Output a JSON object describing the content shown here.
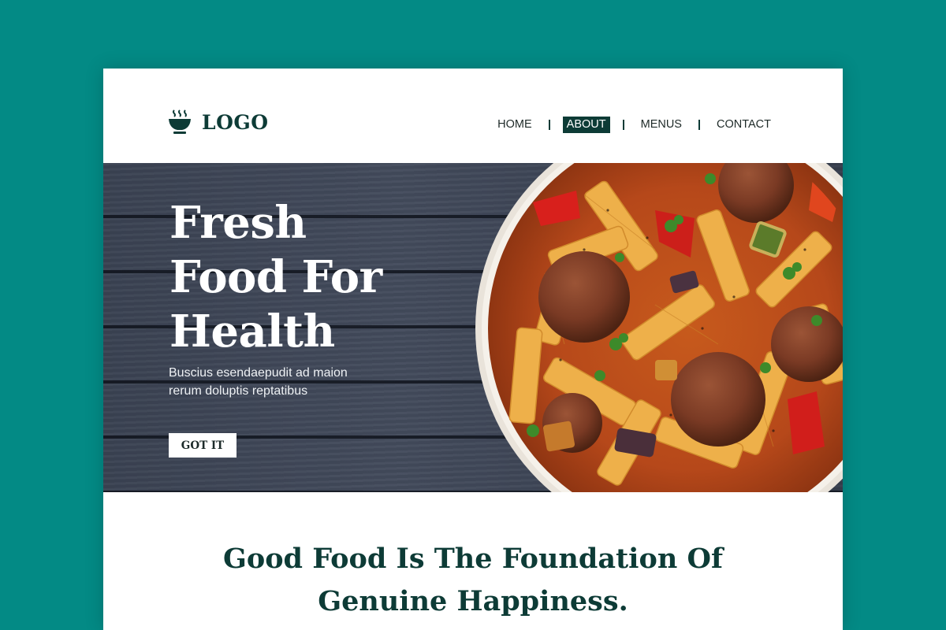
{
  "header": {
    "logo_text": "LOGO",
    "logo_icon": "steaming-bowl-icon",
    "nav": [
      {
        "label": "HOME",
        "active": false
      },
      {
        "label": "ABOUT",
        "active": true
      },
      {
        "label": "MENUS",
        "active": false
      },
      {
        "label": "CONTACT",
        "active": false
      }
    ]
  },
  "hero": {
    "title_lines": [
      "Fresh",
      "Food For",
      "Health"
    ],
    "subtitle_lines": [
      "Buscius esendaepudit ad maion",
      "rerum doluptis reptatibus"
    ],
    "cta_label": "GOT IT",
    "image": "pasta-bowl-with-meatballs"
  },
  "tagline_lines": [
    "Good Food Is The Foundation Of",
    "Genuine Happiness."
  ],
  "colors": {
    "background": "#038a85",
    "brand_dark": "#0d3b36",
    "hero_wood": "#3f4757",
    "card": "#ffffff"
  }
}
